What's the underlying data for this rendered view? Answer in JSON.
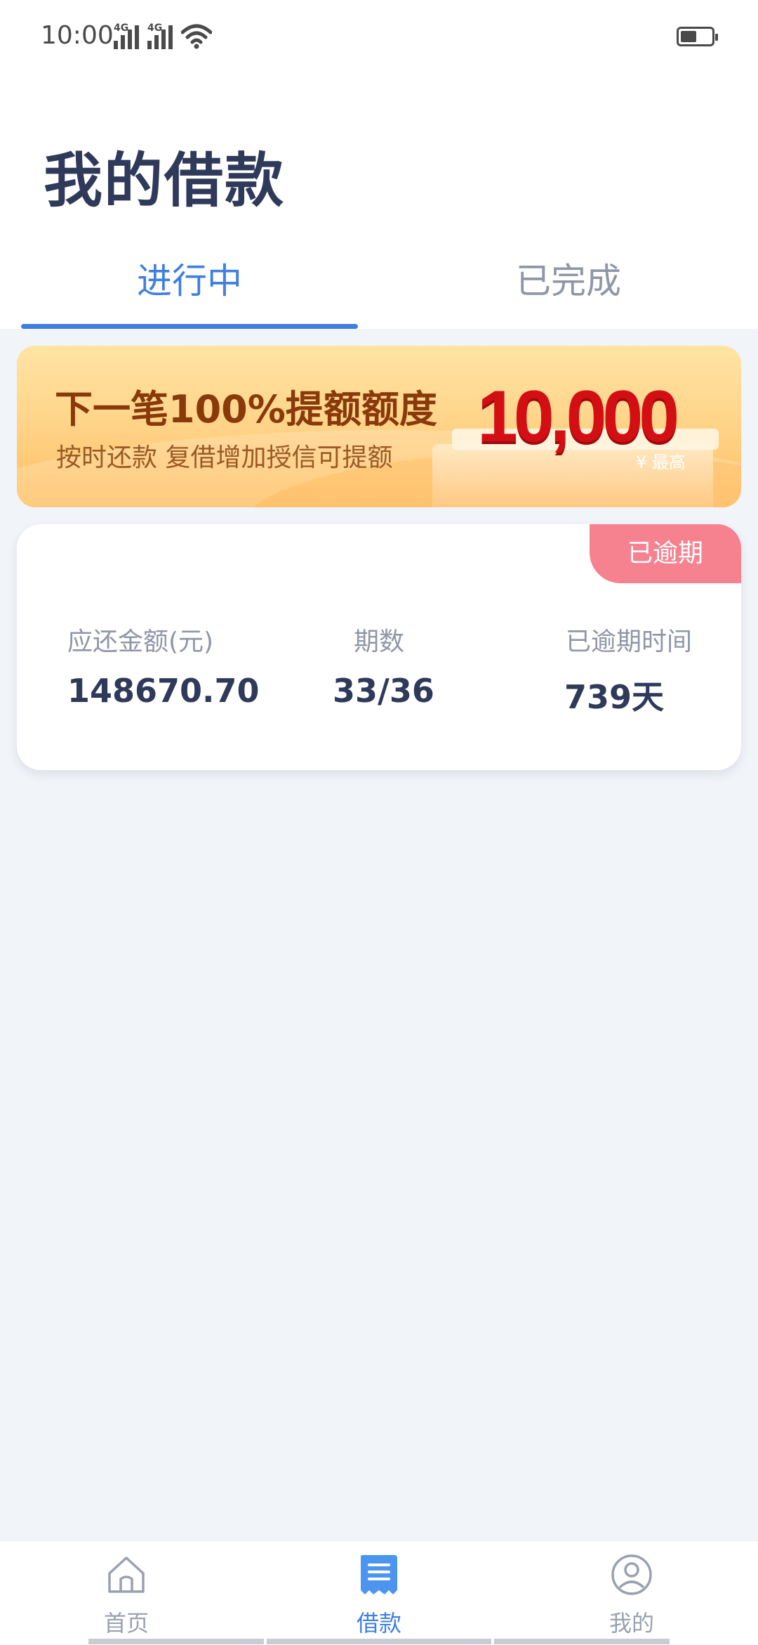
{
  "status_bar": {
    "time": "10:00",
    "network_1": "4G",
    "network_2": "4G",
    "icons": [
      "signal-icon",
      "signal-icon",
      "wifi-icon",
      "battery-icon"
    ]
  },
  "page": {
    "title": "我的借款"
  },
  "tabs": [
    {
      "label": "进行中",
      "active": true
    },
    {
      "label": "已完成",
      "active": false
    }
  ],
  "banner": {
    "headline": "下一笔100%提额额度",
    "subtitle": "按时还款  复借增加授信可提额",
    "amount": "10,000",
    "amount_note": "¥ 最高"
  },
  "loan_card": {
    "status_badge": "已逾期",
    "columns": [
      {
        "label": "应还金额(元)",
        "value": "148670.70"
      },
      {
        "label": "期数",
        "value": "33/36"
      },
      {
        "label": "已逾期时间",
        "value": "739天"
      }
    ]
  },
  "bottom_nav": {
    "items": [
      {
        "label": "首页",
        "icon": "home-icon",
        "active": false
      },
      {
        "label": "借款",
        "icon": "loan-document-icon",
        "active": true
      },
      {
        "label": "我的",
        "icon": "profile-icon",
        "active": false
      }
    ]
  },
  "colors": {
    "accent": "#3f7fe0",
    "title": "#2f3a5b",
    "overdue": "#f6828f",
    "banner_amount": "#d40f14",
    "background": "#f1f4f8"
  }
}
